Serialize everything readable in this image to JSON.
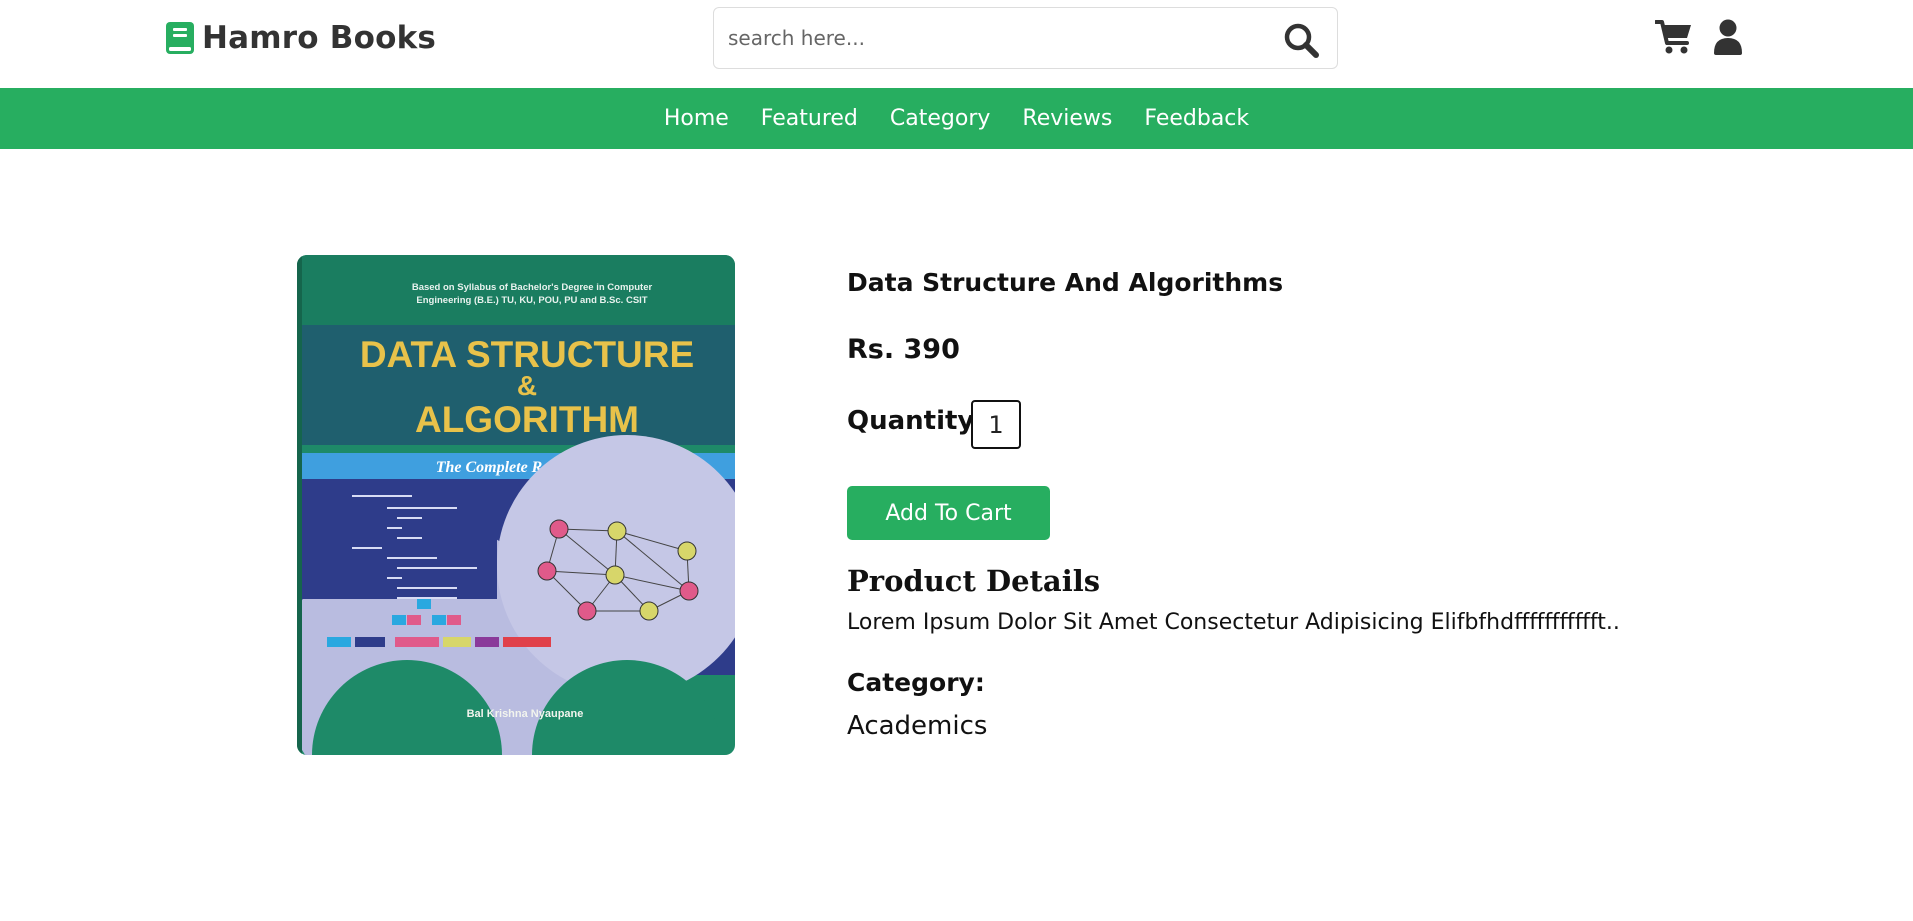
{
  "header": {
    "logo_text": "Hamro Books",
    "search_placeholder": "search here...",
    "search_value": ""
  },
  "nav": {
    "items": [
      {
        "label": "Home"
      },
      {
        "label": "Featured"
      },
      {
        "label": "Category"
      },
      {
        "label": "Reviews"
      },
      {
        "label": "Feedback"
      }
    ]
  },
  "product": {
    "cover": {
      "syllabus_line1": "Based on Syllabus of Bachelor's Degree in Computer",
      "syllabus_line2": "Engineering (B.E.) TU, KU, POU, PU  and  B.Sc. CSIT",
      "title_line1": "DATA STRUCTURE",
      "title_amp": "&",
      "title_line2": "ALGORITHM",
      "subtitle": "The Complete Reference",
      "author": "Bal Krishna Nyaupane"
    },
    "title": "Data Structure And Algorithms",
    "price": "Rs. 390",
    "quantity_label": "Quantity",
    "quantity_value": "1",
    "add_to_cart_label": "Add To Cart",
    "details_heading": "Product Details",
    "details_text": "Lorem Ipsum Dolor Sit Amet Consectetur Adipisicing Elifbfhdffffffffffft..",
    "category_label": "Category:",
    "category_value": "Academics"
  },
  "colors": {
    "brand_green": "#27ae60",
    "text_dark": "#111111"
  },
  "icons": {
    "logo": "book-icon",
    "search": "search-icon",
    "cart": "cart-icon",
    "user": "user-icon"
  }
}
